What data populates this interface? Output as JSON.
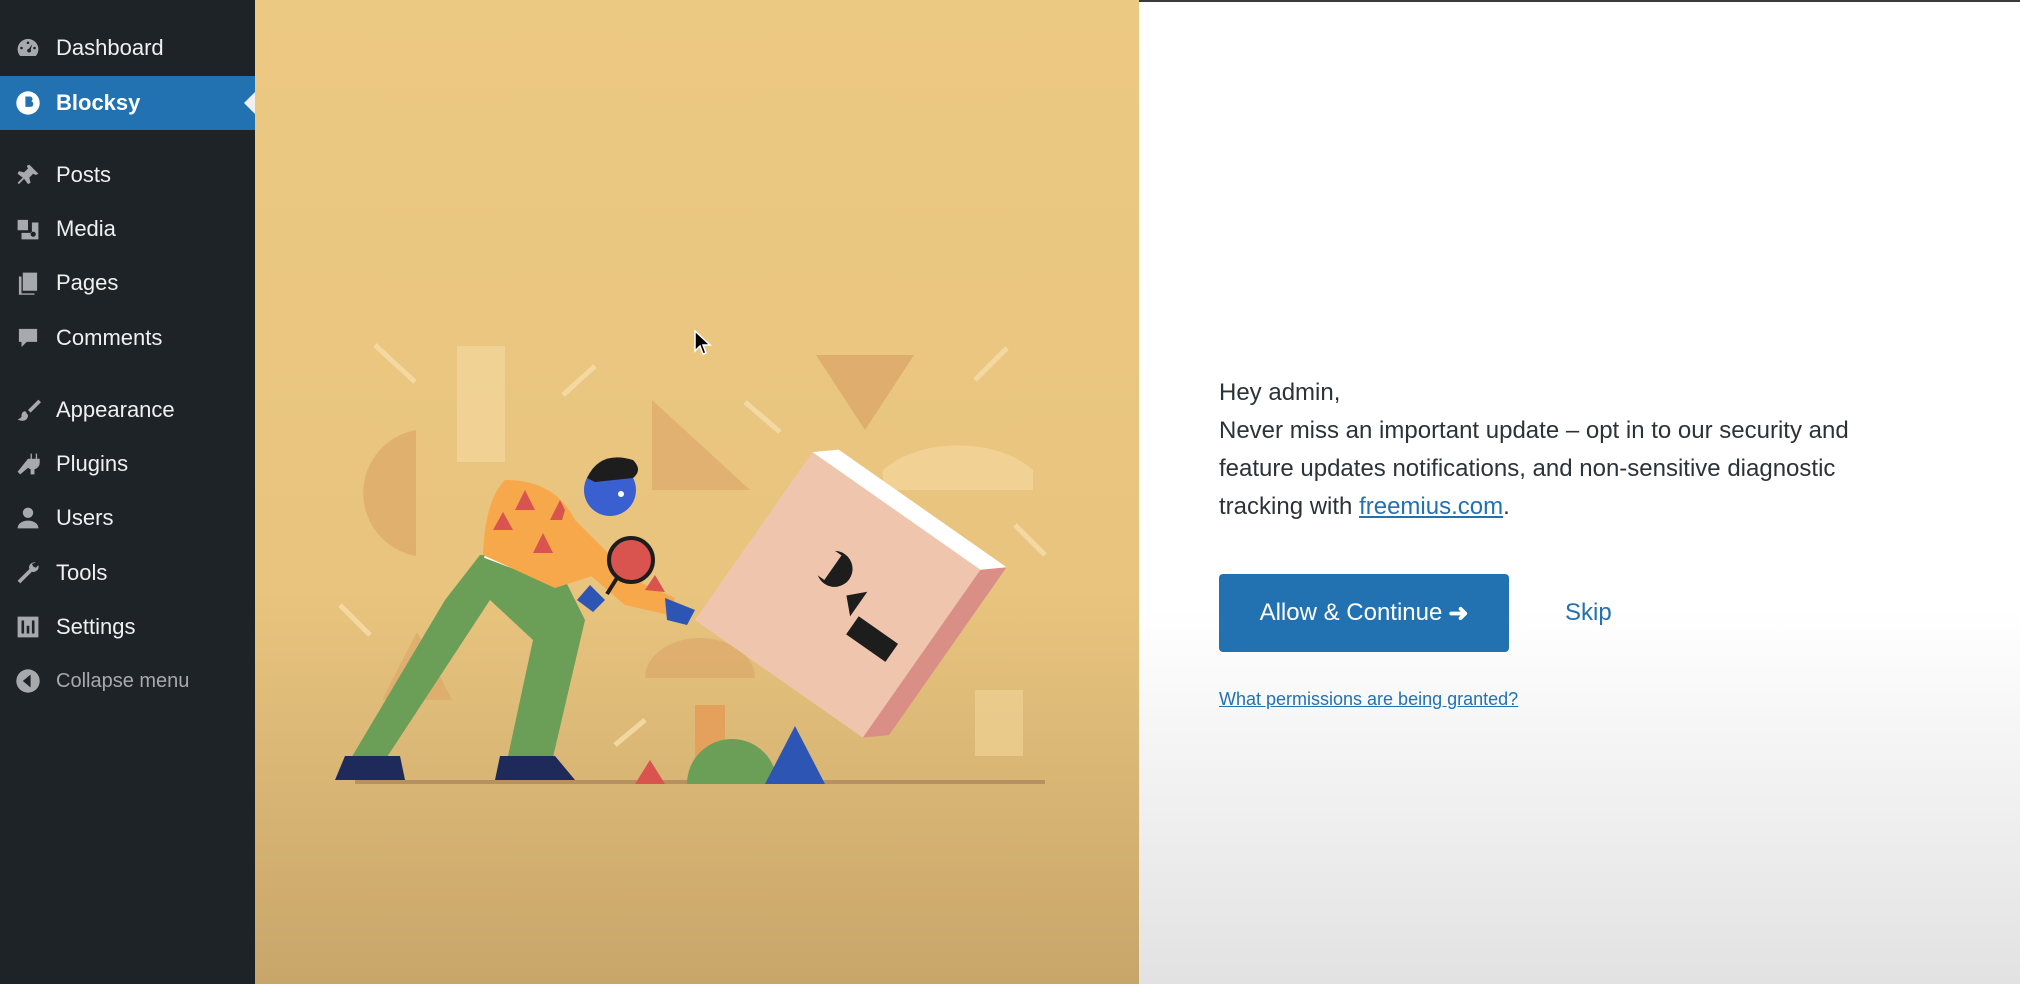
{
  "sidebar": {
    "items": [
      {
        "label": "Dashboard",
        "icon": "dashboard-icon"
      },
      {
        "label": "Blocksy",
        "icon": "blocksy-icon",
        "active": true
      },
      {
        "label": "Posts",
        "icon": "pin-icon"
      },
      {
        "label": "Media",
        "icon": "media-icon"
      },
      {
        "label": "Pages",
        "icon": "pages-icon"
      },
      {
        "label": "Comments",
        "icon": "comment-icon"
      },
      {
        "label": "Appearance",
        "icon": "brush-icon"
      },
      {
        "label": "Plugins",
        "icon": "plug-icon"
      },
      {
        "label": "Users",
        "icon": "user-icon"
      },
      {
        "label": "Tools",
        "icon": "wrench-icon"
      },
      {
        "label": "Settings",
        "icon": "settings-icon"
      }
    ],
    "collapse_label": "Collapse menu"
  },
  "optin": {
    "greeting": "Hey admin,",
    "body_before_link": "Never miss an important update – opt in to our security and feature updates notifications, and non-sensitive diagnostic tracking with ",
    "link_text": "freemius.com",
    "body_after_link": ".",
    "allow_label": "Allow & Continue",
    "skip_label": "Skip",
    "permissions_label": "What permissions are being granted?"
  },
  "colors": {
    "sidebar_bg": "#1d2327",
    "accent": "#2271b1",
    "illustration_bg": "#ecc983"
  }
}
